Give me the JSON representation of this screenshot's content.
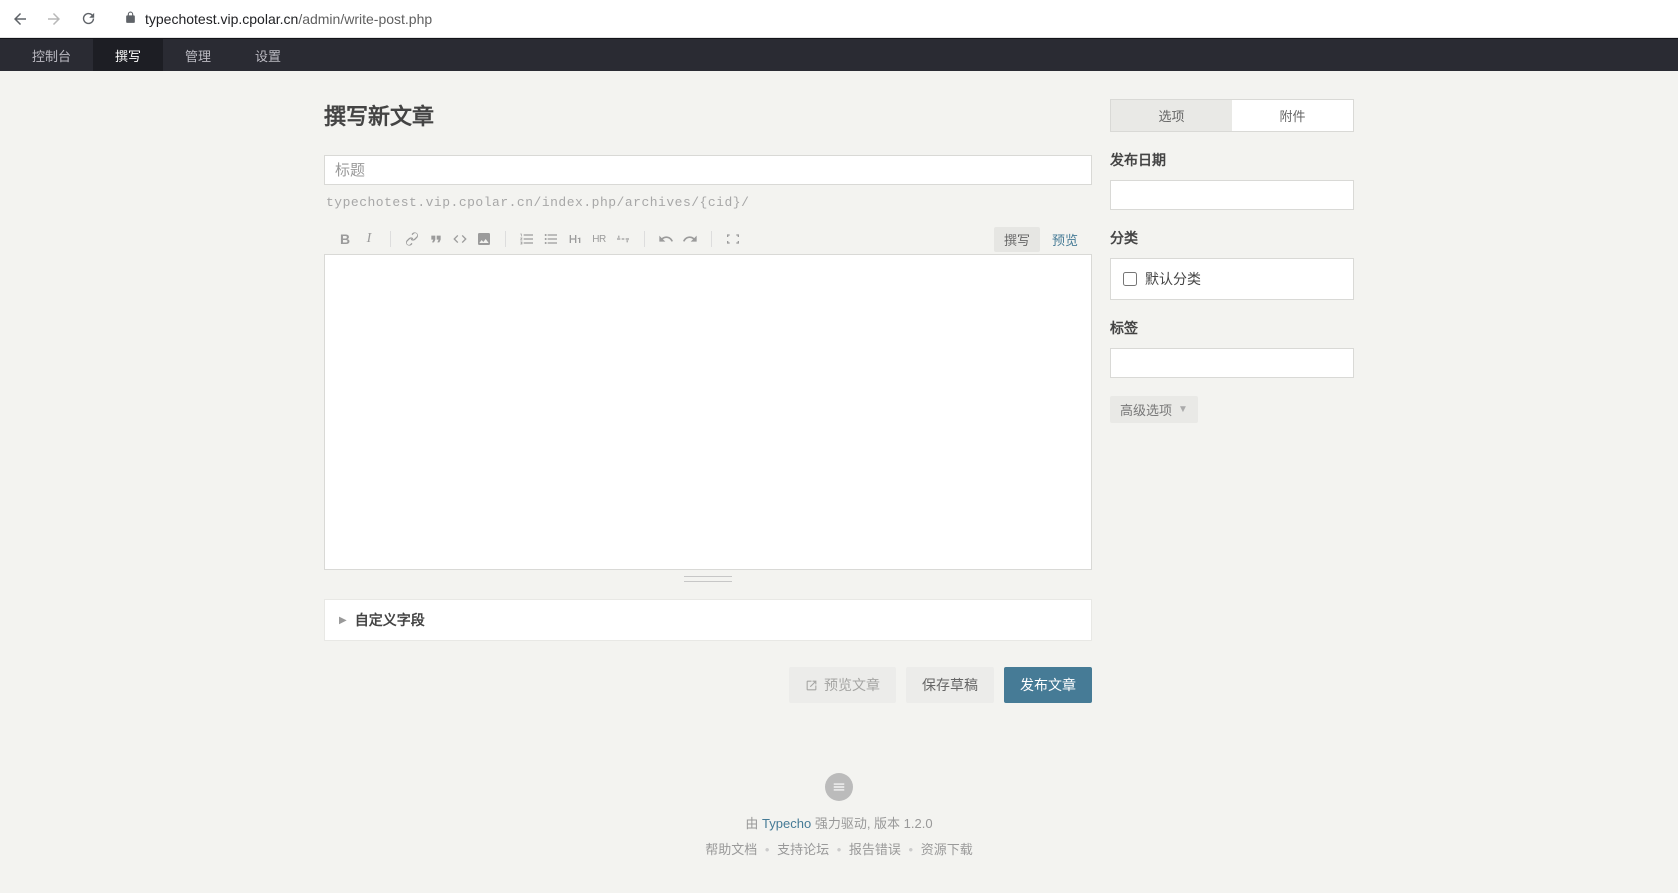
{
  "browser": {
    "url_host": "typechotest.vip.cpolar.cn",
    "url_path": "/admin/write-post.php"
  },
  "nav": {
    "items": [
      "控制台",
      "撰写",
      "管理",
      "设置"
    ],
    "active_index": 1
  },
  "page": {
    "title": "撰写新文章"
  },
  "editor": {
    "title_placeholder": "标题",
    "title_value": "",
    "slug": "typechotest.vip.cpolar.cn/index.php/archives/{cid}/",
    "mode_write": "撰写",
    "mode_preview": "预览",
    "content": ""
  },
  "custom_fields": {
    "label": "自定义字段"
  },
  "actions": {
    "preview": "预览文章",
    "save_draft": "保存草稿",
    "publish": "发布文章"
  },
  "sidebar": {
    "tab_options": "选项",
    "tab_attach": "附件",
    "publish_date_label": "发布日期",
    "publish_date_value": "",
    "category_label": "分类",
    "category_default": "默认分类",
    "tags_label": "标签",
    "tags_value": "",
    "advanced_label": "高级选项"
  },
  "footer": {
    "powered_prefix": "由 ",
    "typecho": "Typecho",
    "powered_suffix": " 强力驱动, 版本 1.2.0",
    "links": [
      "帮助文档",
      "支持论坛",
      "报告错误",
      "资源下载"
    ]
  }
}
